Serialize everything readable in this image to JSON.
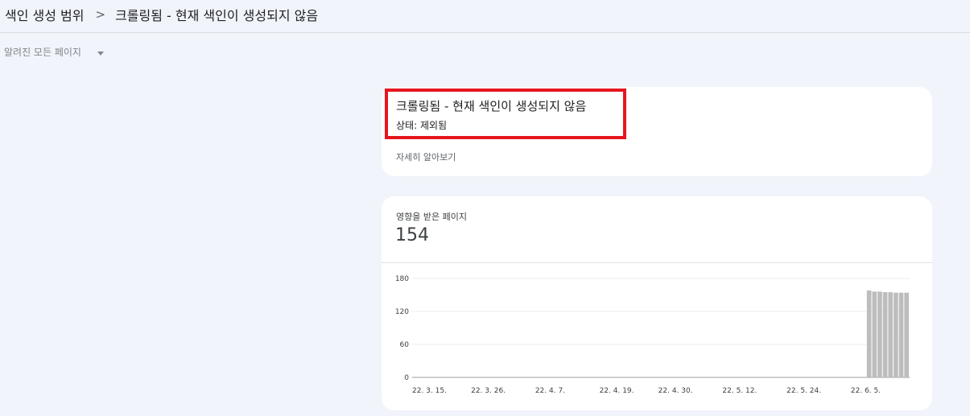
{
  "breadcrumb": {
    "parent": "색인 생성 범위",
    "separator": ">",
    "current": "크롤링됨 - 현재 색인이 생성되지 않음"
  },
  "filter": {
    "selected": "알려진 모든 페이지"
  },
  "info_card": {
    "title": "크롤링됨 - 현재 색인이 생성되지 않음",
    "status": "상태: 제외됨",
    "learn_more": "자세히 알아보기",
    "highlight_color": "#e5161f"
  },
  "metric": {
    "label": "영향을 받은 페이지",
    "value": "154"
  },
  "chart_data": {
    "type": "bar",
    "x_tick_labels": [
      "22. 3. 15.",
      "22. 3. 26.",
      "22. 4. 7.",
      "22. 4. 19.",
      "22. 4. 30.",
      "22. 5. 12.",
      "22. 5. 24.",
      "22. 6. 5."
    ],
    "y_ticks": [
      0,
      60,
      120,
      180
    ],
    "ylim": [
      0,
      180
    ],
    "total_days": 93,
    "x_tick_day_index": [
      0,
      11,
      23,
      35,
      46,
      58,
      70,
      82
    ],
    "bars": [
      {
        "day_index": 85,
        "value": 158
      },
      {
        "day_index": 86,
        "value": 156
      },
      {
        "day_index": 87,
        "value": 156
      },
      {
        "day_index": 88,
        "value": 155
      },
      {
        "day_index": 89,
        "value": 155
      },
      {
        "day_index": 90,
        "value": 154
      },
      {
        "day_index": 91,
        "value": 154
      },
      {
        "day_index": 92,
        "value": 154
      }
    ],
    "bar_color": "#bdbdbd",
    "grid": true
  }
}
